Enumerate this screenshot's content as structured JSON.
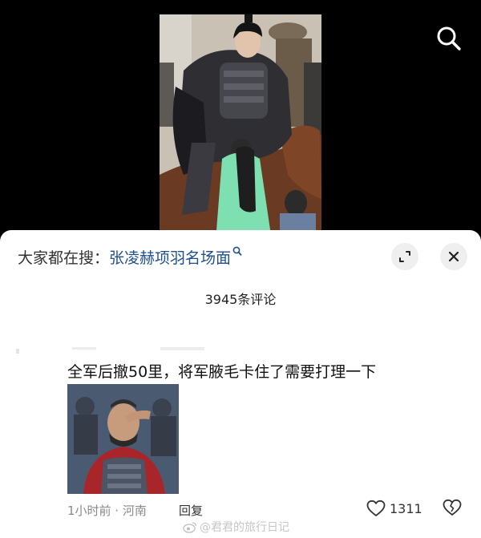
{
  "video": {
    "thumbnail_icon": "costume-drama-rider-scene",
    "search_icon": "search-icon"
  },
  "sheet": {
    "trending_prefix": "大家都在搜：",
    "trending_query": "张凌赫项羽名场面",
    "trending_icon": "search-small-icon",
    "expand_icon": "expand-icon",
    "close_icon": "close-icon",
    "comment_count": "3945条评论"
  },
  "comment": {
    "text": "全军后撤50里，将军腋毛卡住了需要打理一下",
    "image_icon": "general-meme-image",
    "meta": "1小时前 · 河南",
    "reply": "回复",
    "likes": "1311",
    "like_icon": "heart-icon",
    "dislike_icon": "broken-heart-icon"
  },
  "watermark": "@君君的旅行日记",
  "colors": {
    "link": "#1f4f8f",
    "sheet_bg": "#ffffff",
    "page_bg": "#000000"
  }
}
